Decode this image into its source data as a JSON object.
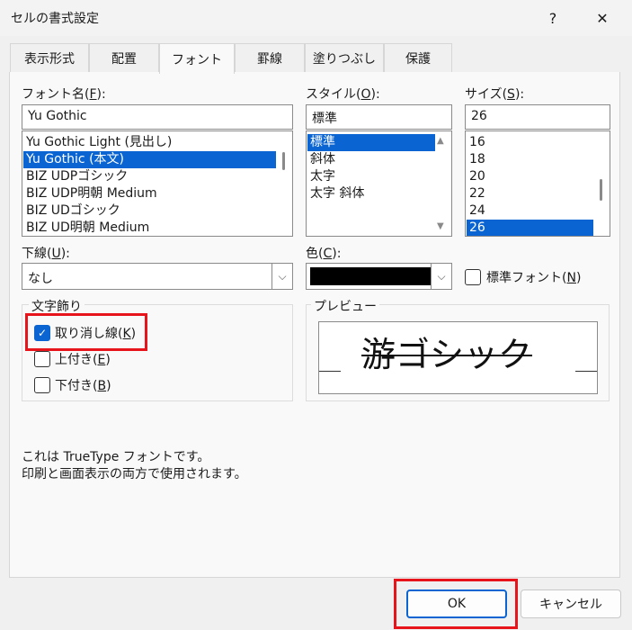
{
  "dialog": {
    "title": "セルの書式設定",
    "help": "?",
    "close": "✕"
  },
  "tabs": [
    {
      "label": "表示形式"
    },
    {
      "label": "配置"
    },
    {
      "label": "フォント"
    },
    {
      "label": "罫線"
    },
    {
      "label": "塗りつぶし"
    },
    {
      "label": "保護"
    }
  ],
  "font_name": {
    "label": "フォント名(",
    "accel": "F",
    "label_end": "):",
    "value": "Yu Gothic",
    "items": [
      "Yu Gothic Light (見出し)",
      "Yu Gothic (本文)",
      "BIZ UDPゴシック",
      "BIZ UDP明朝 Medium",
      "BIZ UDゴシック",
      "BIZ UD明朝 Medium"
    ],
    "selected_index": 1
  },
  "style": {
    "label": "スタイル(",
    "accel": "O",
    "label_end": "):",
    "value": "標準",
    "items": [
      "標準",
      "斜体",
      "太字",
      "太字 斜体"
    ],
    "selected_index": 0
  },
  "size": {
    "label": "サイズ(",
    "accel": "S",
    "label_end": "):",
    "value": "26",
    "items": [
      "16",
      "18",
      "20",
      "22",
      "24",
      "26"
    ],
    "selected_index": 5
  },
  "underline": {
    "label": "下線(",
    "accel": "U",
    "label_end": "):",
    "value": "なし"
  },
  "color": {
    "label": "色(",
    "accel": "C",
    "label_end": "):",
    "swatch": "#000000"
  },
  "normal_font": {
    "label": "標準フォント(",
    "accel": "N",
    "label_end": ")",
    "checked": false
  },
  "effects": {
    "group_label": "文字飾り",
    "strikethrough": {
      "label": "取り消し線(",
      "accel": "K",
      "label_end": ")",
      "checked": true
    },
    "superscript": {
      "label": "上付き(",
      "accel": "E",
      "label_end": ")",
      "checked": false
    },
    "subscript": {
      "label": "下付き(",
      "accel": "B",
      "label_end": ")",
      "checked": false
    }
  },
  "preview": {
    "group_label": "プレビュー",
    "sample_text": "游ゴシック"
  },
  "info": {
    "line1": "これは TrueType フォントです。",
    "line2": "印刷と画面表示の両方で使用されます。"
  },
  "buttons": {
    "ok": "OK",
    "cancel": "キャンセル"
  },
  "colors": {
    "accent": "#0a64d2",
    "highlight_box": "#e8141b"
  },
  "icons": {
    "check": "check-icon",
    "dropdown": "chevron-down-icon",
    "close": "close-icon",
    "help": "help-icon"
  }
}
